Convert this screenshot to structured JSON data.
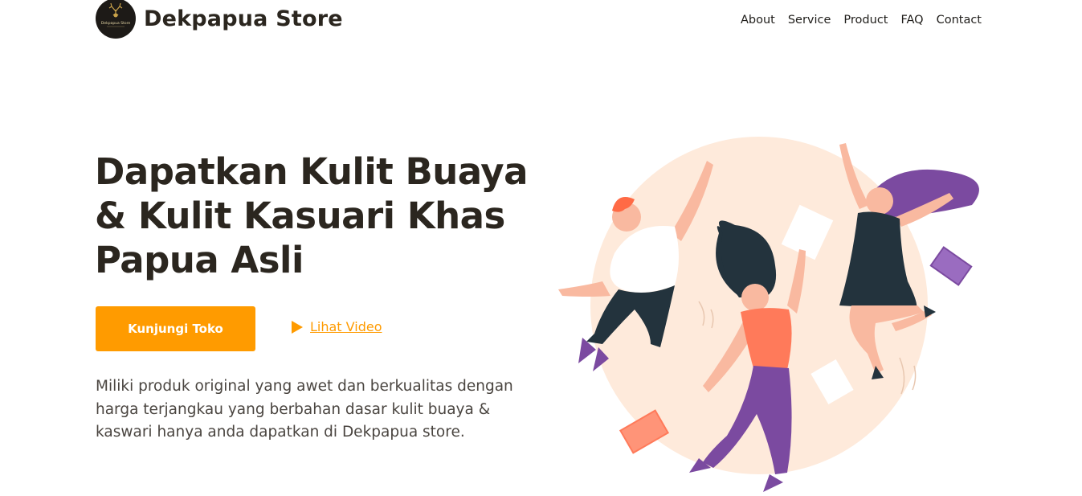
{
  "header": {
    "brand_name": "Dekpapua Store",
    "logo_text": "Dekpapua Store",
    "nav": [
      {
        "label": "About"
      },
      {
        "label": "Service"
      },
      {
        "label": "Product"
      },
      {
        "label": "FAQ"
      },
      {
        "label": "Contact"
      }
    ]
  },
  "hero": {
    "title_lines": [
      "Dapatkan Kulit Buaya",
      "& Kulit Kasuari Khas",
      "Papua Asli"
    ],
    "primary_button": "Kunjungi Toko",
    "video_link": "Lihat Video",
    "description": "Miliki produk original yang awet dan berkualitas dengan harga terjangkau yang berbahan dasar kulit buaya & kaswari hanya anda dapatkan di Dekpapua store."
  },
  "colors": {
    "accent": "#ff9b00",
    "heading": "#2b261f",
    "text": "#4a4540",
    "illustration_circle": "#fde3cf",
    "purple": "#7b4aa0",
    "coral": "#ff7a5a",
    "dark": "#23333d"
  },
  "icons": {
    "play": "play-icon",
    "logo": "deer-logo-icon"
  }
}
